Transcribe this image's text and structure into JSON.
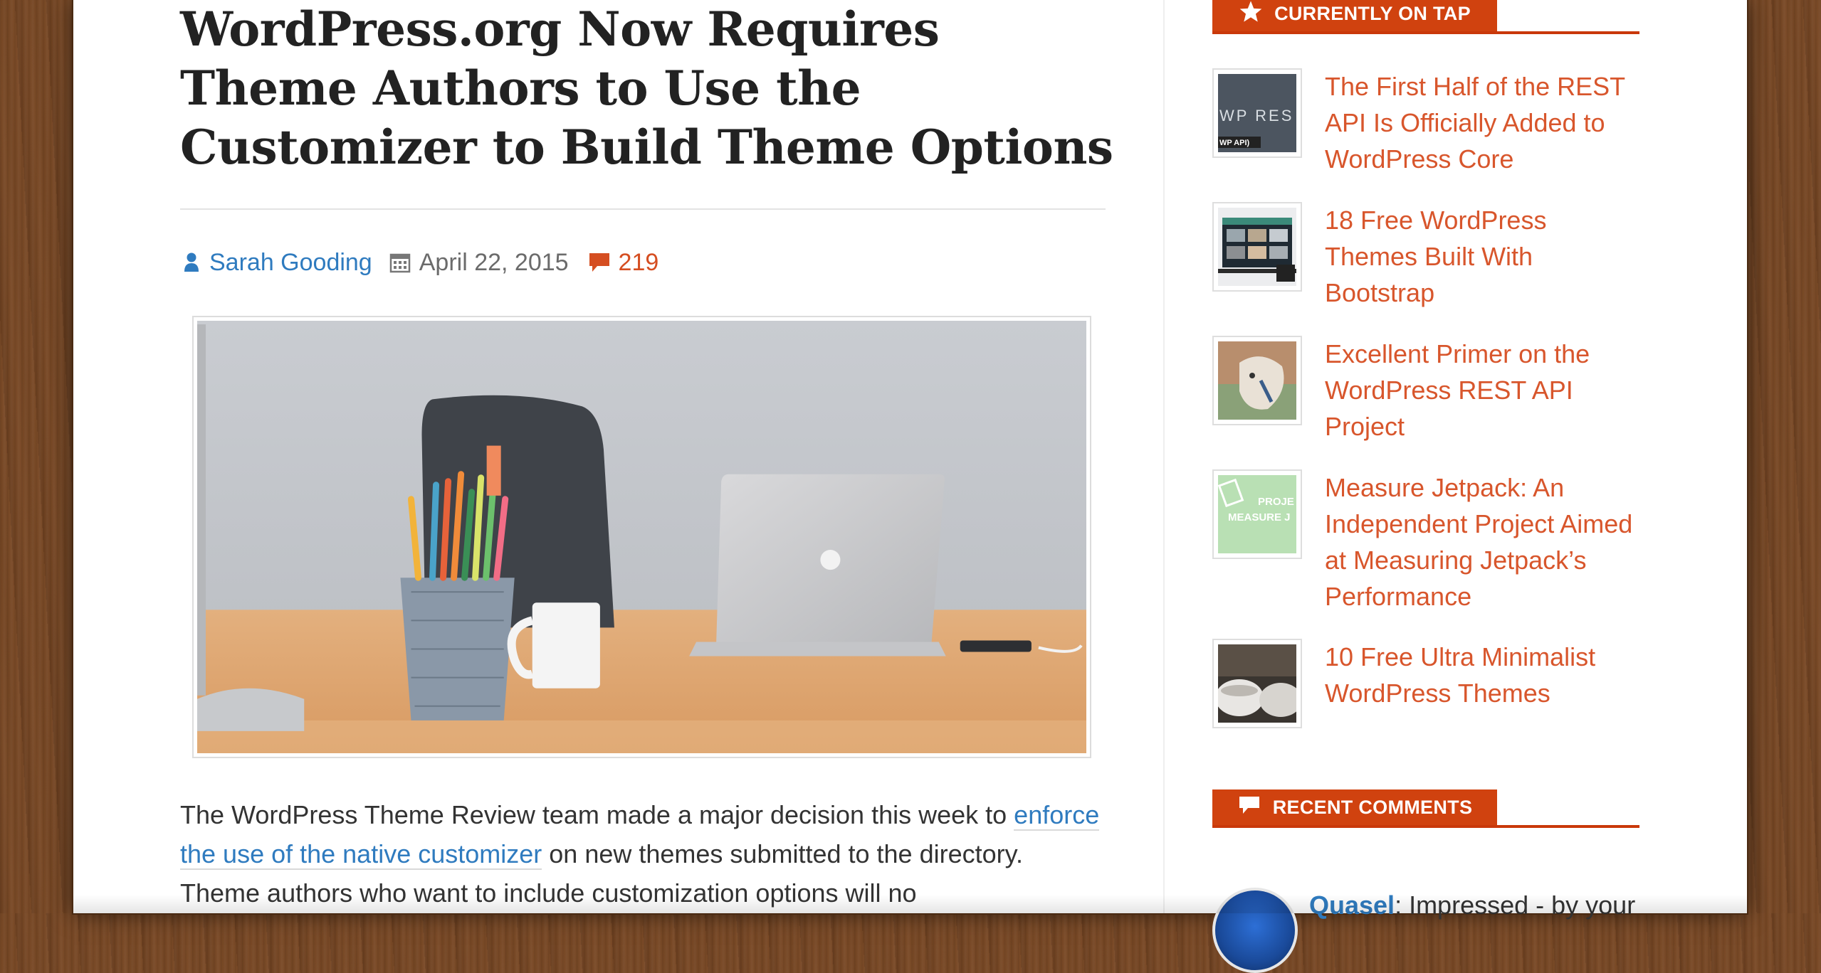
{
  "article": {
    "title": "WordPress.org Now Requires Theme Authors to Use the Customizer to Build Theme Options",
    "author": "Sarah Gooding",
    "date": "April 22, 2015",
    "comment_count": "219",
    "body_before_link": "The WordPress Theme Review team made a major decision this week to ",
    "body_link": "enforce the use of the native customizer",
    "body_after_link": " on new themes submitted to the directory. Theme authors who want to include customization options will no"
  },
  "sidebar": {
    "widget_currently": {
      "label": "CURRENTLY ON TAP",
      "icon": "star-icon"
    },
    "posts": [
      {
        "title": "The First Half of the REST API Is Officially Added to WordPress Core",
        "thumb_text": "WP RES",
        "thumb_badge": "WP API)"
      },
      {
        "title": "18 Free WordPress Themes Built With Bootstrap"
      },
      {
        "title": "Excellent Primer on the WordPress REST API Project"
      },
      {
        "title": "Measure Jetpack: An Independent Project Aimed at Measuring Jetpack’s Performance",
        "thumb_line1": "PROJE",
        "thumb_line2": "MEASURE J"
      },
      {
        "title": "10 Free Ultra Minimalist WordPress Themes"
      }
    ],
    "widget_recent_comments": {
      "label": "RECENT COMMENTS",
      "icon": "speech-bubble-icon"
    },
    "recent_comment": {
      "author": "Quasel",
      "text": ": Impressed - by your"
    }
  },
  "colors": {
    "accent": "#d0420f",
    "link_blue": "#2f7bbf",
    "post_link": "#d8562c",
    "title_text": "#222222"
  }
}
